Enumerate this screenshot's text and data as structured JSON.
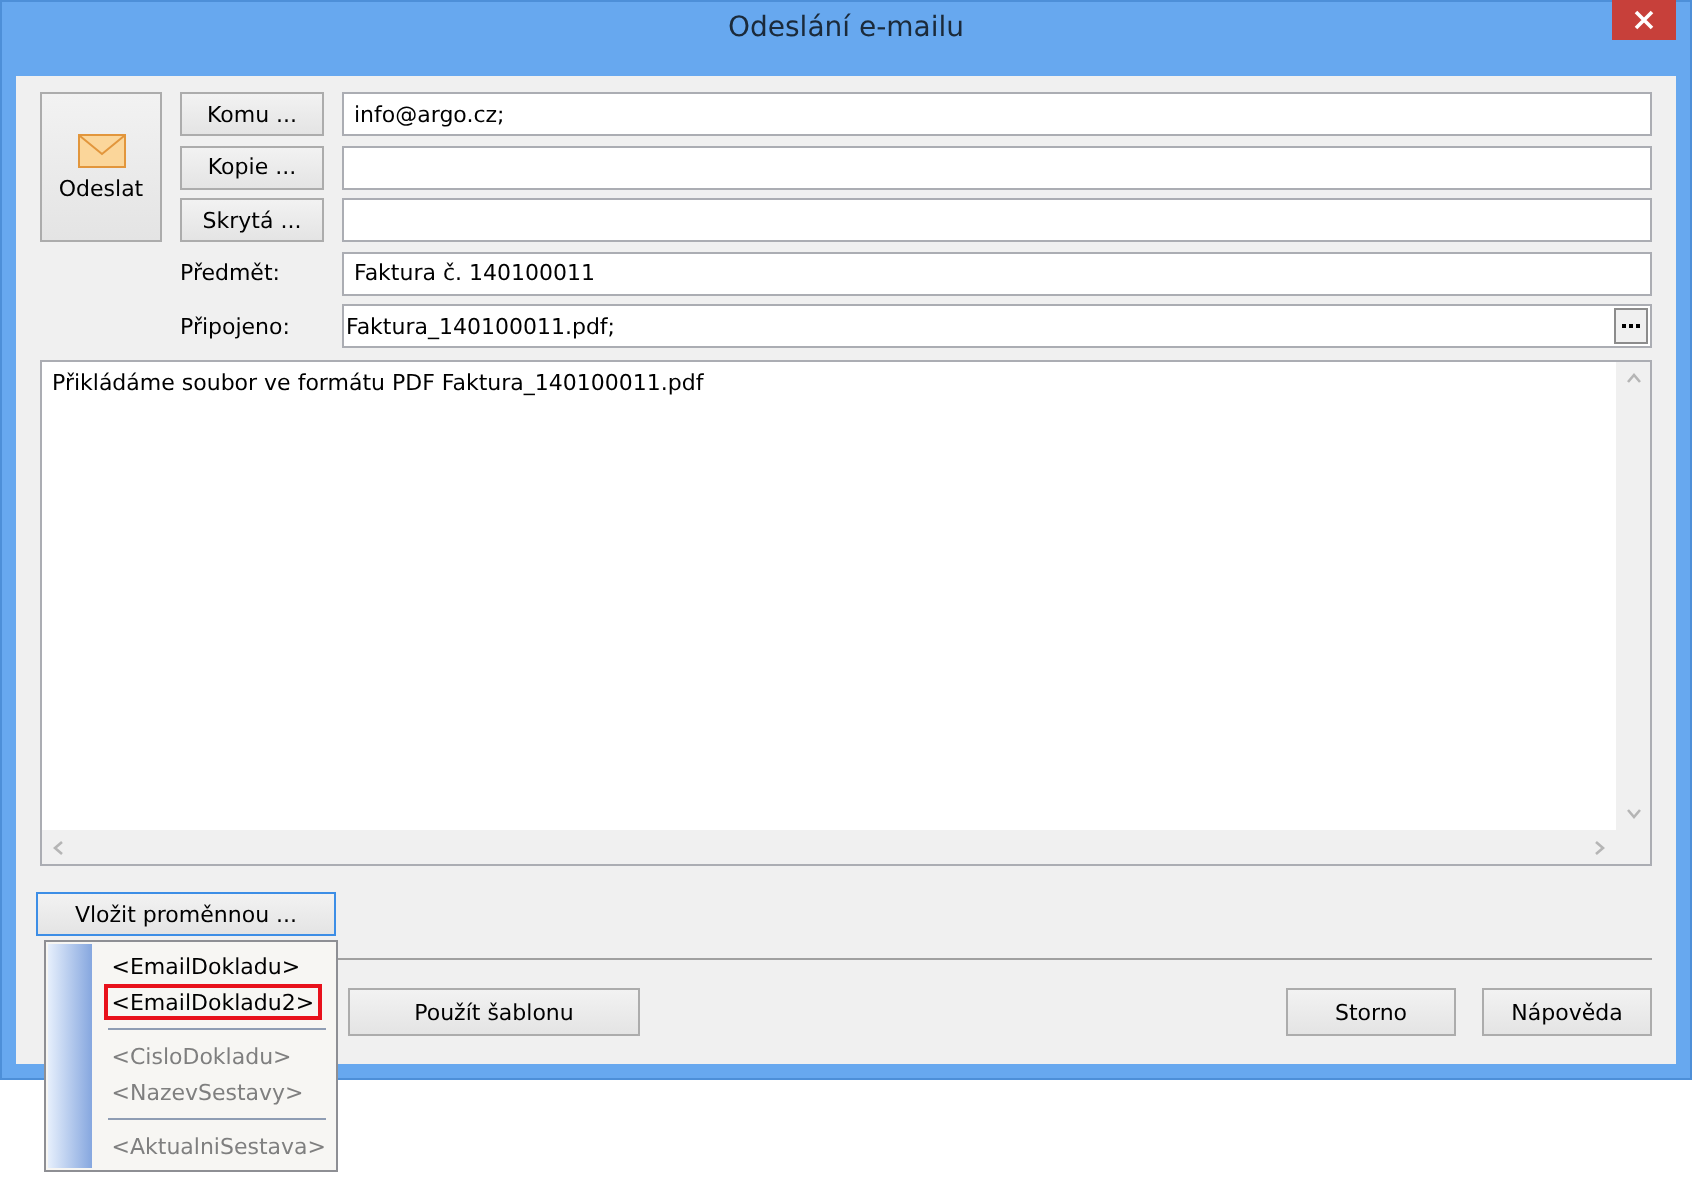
{
  "window": {
    "title": "Odeslání e-mailu"
  },
  "send_button": "Odeslat",
  "recipients": [
    {
      "button": "Komu ...",
      "value": "info@argo.cz;"
    },
    {
      "button": "Kopie ..."
    },
    {
      "button": "Skrytá ..."
    }
  ],
  "subject": {
    "label": "Předmět:",
    "value": "Faktura č. 140100011"
  },
  "attachment": {
    "label": "Připojeno:",
    "value": "Faktura_140100011.pdf;"
  },
  "body": "Přikládáme soubor ve formátu PDF Faktura_140100011.pdf",
  "insert_variable_button": {
    "label": "Vložit proměnnou ...",
    "focused": true
  },
  "variable_menu": [
    {
      "kind": "item",
      "label": "<EmailDokladu>",
      "disabled": false,
      "marked": false
    },
    {
      "kind": "item",
      "label": "<EmailDokladu2>",
      "disabled": false,
      "marked": true
    },
    {
      "kind": "separator"
    },
    {
      "kind": "item",
      "label": "<CisloDokladu>",
      "disabled": true,
      "marked": false
    },
    {
      "kind": "item",
      "label": "<NazevSestavy>",
      "disabled": true,
      "marked": false
    },
    {
      "kind": "separator"
    },
    {
      "kind": "item",
      "label": "<AktualniSestava>",
      "disabled": true,
      "marked": false
    }
  ],
  "template_button": "Použít šablonu",
  "buttons": [
    "Storno",
    "Nápověda"
  ]
}
